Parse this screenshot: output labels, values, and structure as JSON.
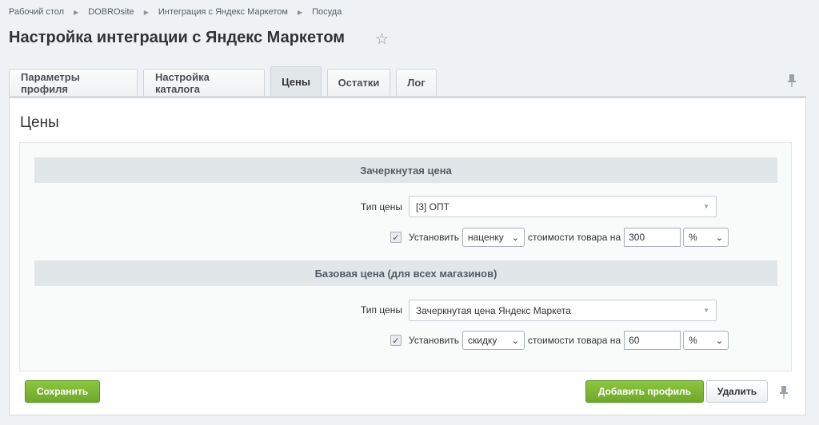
{
  "breadcrumb": [
    "Рабочий стол",
    "DOBROsite",
    "Интеграция с Яндекс Маркетом",
    "Посуда"
  ],
  "page_title": "Настройка интеграции с Яндекс Маркетом",
  "tabs": [
    {
      "label": "Параметры профиля",
      "active": false
    },
    {
      "label": "Настройка каталога",
      "active": false
    },
    {
      "label": "Цены",
      "active": true
    },
    {
      "label": "Остатки",
      "active": false
    },
    {
      "label": "Лог",
      "active": false
    }
  ],
  "section_title": "Цены",
  "groups": [
    {
      "heading": "Зачеркнутая цена",
      "price_type_label": "Тип цены",
      "price_type_value": "[3] ОПТ",
      "checkbox_checked": true,
      "set_label": "Установить",
      "mode_value": "наценку",
      "of_price_label": "стоимости товара на",
      "amount": "300",
      "unit": "%"
    },
    {
      "heading": "Базовая цена (для всех магазинов)",
      "price_type_label": "Тип цены",
      "price_type_value": "Зачеркнутая цена Яндекс Маркета",
      "checkbox_checked": true,
      "set_label": "Установить",
      "mode_value": "скидку",
      "of_price_label": "стоимости товара на",
      "amount": "60",
      "unit": "%"
    }
  ],
  "buttons": {
    "save": "Сохранить",
    "add_profile": "Добавить профиль",
    "delete": "Удалить"
  },
  "colors": {
    "accent_green": "#7ab536",
    "background": "#eef2f4"
  }
}
